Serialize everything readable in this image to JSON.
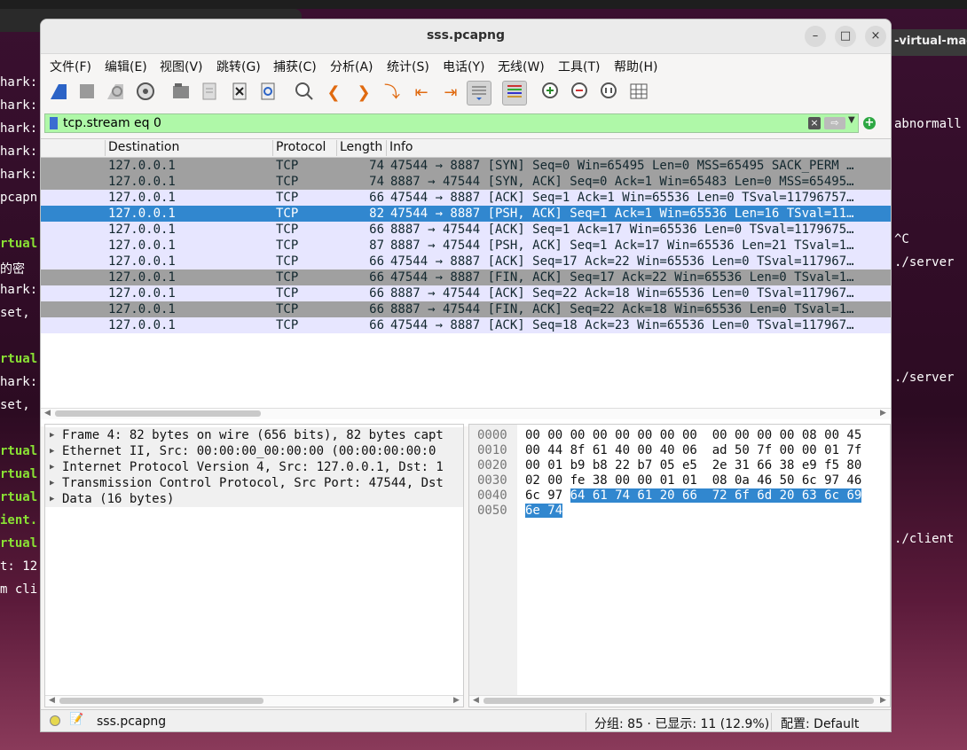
{
  "window": {
    "title": "sss.pcapng",
    "minimize": "–",
    "maximize": "□",
    "close": "×"
  },
  "background": {
    "right_tab": "-virtual-mac",
    "left_terminal": [
      {
        "text": "hark:",
        "color": "white"
      },
      {
        "text": "hark:",
        "color": "white"
      },
      {
        "text": "hark:",
        "color": "white"
      },
      {
        "text": "hark:",
        "color": "white"
      },
      {
        "text": "hark:",
        "color": "white"
      },
      {
        "text": "pcapn",
        "color": "white"
      },
      {
        "text": "rtual",
        "color": "green"
      },
      {
        "text": " 的密",
        "color": "white"
      },
      {
        "text": "hark:",
        "color": "white"
      },
      {
        "text": " set,",
        "color": "white"
      },
      {
        "text": "rtual",
        "color": "green"
      },
      {
        "text": "hark:",
        "color": "white"
      },
      {
        "text": " set,",
        "color": "white"
      },
      {
        "text": "rtual",
        "color": "green"
      },
      {
        "text": "rtual",
        "color": "green"
      },
      {
        "text": "rtual",
        "color": "green"
      },
      {
        "text": "ient.",
        "color": "green"
      },
      {
        "text": "rtual",
        "color": "green"
      },
      {
        "text": "t: 12",
        "color": "white"
      },
      {
        "text": "m cli",
        "color": "white"
      }
    ],
    "right_terminal": [
      "abnormall",
      "^C",
      "./server",
      "./server",
      "./client"
    ]
  },
  "menu": [
    "文件(F)",
    "编辑(E)",
    "视图(V)",
    "跳转(G)",
    "捕获(C)",
    "分析(A)",
    "统计(S)",
    "电话(Y)",
    "无线(W)",
    "工具(T)",
    "帮助(H)"
  ],
  "toolbar": [
    {
      "name": "start-capture-icon"
    },
    {
      "name": "stop-capture-icon"
    },
    {
      "name": "restart-capture-icon"
    },
    {
      "name": "capture-options-icon"
    },
    {
      "name": "open-file-icon"
    },
    {
      "name": "save-file-icon"
    },
    {
      "name": "close-file-icon"
    },
    {
      "name": "reload-file-icon"
    },
    {
      "name": "find-packet-icon"
    },
    {
      "name": "go-back-icon"
    },
    {
      "name": "go-forward-icon"
    },
    {
      "name": "go-to-packet-icon"
    },
    {
      "name": "go-first-icon"
    },
    {
      "name": "go-last-icon"
    },
    {
      "name": "autoscroll-icon"
    },
    {
      "name": "colorize-icon"
    },
    {
      "name": "zoom-in-icon"
    },
    {
      "name": "zoom-out-icon"
    },
    {
      "name": "zoom-normal-icon"
    },
    {
      "name": "resize-columns-icon"
    }
  ],
  "filter": {
    "value": "tcp.stream eq 0",
    "clear": "×",
    "apply": "⇨",
    "add": "+"
  },
  "columns": {
    "destination": "Destination",
    "protocol": "Protocol",
    "length": "Length",
    "info": "Info"
  },
  "packets": [
    {
      "dst": "127.0.0.1",
      "proto": "TCP",
      "len": "74",
      "info": "47544 → 8887 [SYN] Seq=0 Win=65495 Len=0 MSS=65495 SACK_PERM …",
      "style": "dark"
    },
    {
      "dst": "127.0.0.1",
      "proto": "TCP",
      "len": "74",
      "info": "8887 → 47544 [SYN, ACK] Seq=0 Ack=1 Win=65483 Len=0 MSS=65495…",
      "style": "dark"
    },
    {
      "dst": "127.0.0.1",
      "proto": "TCP",
      "len": "66",
      "info": "47544 → 8887 [ACK] Seq=1 Ack=1 Win=65536 Len=0 TSval=11796757…",
      "style": "light"
    },
    {
      "dst": "127.0.0.1",
      "proto": "TCP",
      "len": "82",
      "info": "47544 → 8887 [PSH, ACK] Seq=1 Ack=1 Win=65536 Len=16 TSval=11…",
      "style": "sel"
    },
    {
      "dst": "127.0.0.1",
      "proto": "TCP",
      "len": "66",
      "info": "8887 → 47544 [ACK] Seq=1 Ack=17 Win=65536 Len=0 TSval=1179675…",
      "style": "light"
    },
    {
      "dst": "127.0.0.1",
      "proto": "TCP",
      "len": "87",
      "info": "8887 → 47544 [PSH, ACK] Seq=1 Ack=17 Win=65536 Len=21 TSval=1…",
      "style": "light"
    },
    {
      "dst": "127.0.0.1",
      "proto": "TCP",
      "len": "66",
      "info": "47544 → 8887 [ACK] Seq=17 Ack=22 Win=65536 Len=0 TSval=117967…",
      "style": "light"
    },
    {
      "dst": "127.0.0.1",
      "proto": "TCP",
      "len": "66",
      "info": "47544 → 8887 [FIN, ACK] Seq=17 Ack=22 Win=65536 Len=0 TSval=1…",
      "style": "dark"
    },
    {
      "dst": "127.0.0.1",
      "proto": "TCP",
      "len": "66",
      "info": "8887 → 47544 [ACK] Seq=22 Ack=18 Win=65536 Len=0 TSval=117967…",
      "style": "light"
    },
    {
      "dst": "127.0.0.1",
      "proto": "TCP",
      "len": "66",
      "info": "8887 → 47544 [FIN, ACK] Seq=22 Ack=18 Win=65536 Len=0 TSval=1…",
      "style": "dark"
    },
    {
      "dst": "127.0.0.1",
      "proto": "TCP",
      "len": "66",
      "info": "47544 → 8887 [ACK] Seq=18 Ack=23 Win=65536 Len=0 TSval=117967…",
      "style": "light"
    }
  ],
  "details": [
    "Frame 4: 82 bytes on wire (656 bits), 82 bytes capt",
    "Ethernet II, Src: 00:00:00_00:00:00 (00:00:00:00:0",
    "Internet Protocol Version 4, Src: 127.0.0.1, Dst: 1",
    "Transmission Control Protocol, Src Port: 47544, Dst",
    "Data (16 bytes)"
  ],
  "bytes": {
    "offsets": [
      "0000",
      "0010",
      "0020",
      "0030",
      "0040",
      "0050"
    ],
    "rows": [
      {
        "plain": "00 00 00 00 00 00 00 00  00 00 00 00 08 00 45",
        "hl": ""
      },
      {
        "plain": "00 44 8f 61 40 00 40 06  ad 50 7f 00 00 01 7f",
        "hl": ""
      },
      {
        "plain": "00 01 b9 b8 22 b7 05 e5  2e 31 66 38 e9 f5 80",
        "hl": ""
      },
      {
        "plain": "02 00 fe 38 00 00 01 01  08 0a 46 50 6c 97 46",
        "hl": ""
      },
      {
        "plain": "6c 97 ",
        "hl": "64 61 74 61 20 66  72 6f 6d 20 63 6c 69"
      },
      {
        "plain": "",
        "hl": "6e 74"
      }
    ]
  },
  "status": {
    "file": "sss.pcapng",
    "packets": "分组: 85 · 已显示: 11 (12.9%)",
    "profile": "配置: Default"
  }
}
